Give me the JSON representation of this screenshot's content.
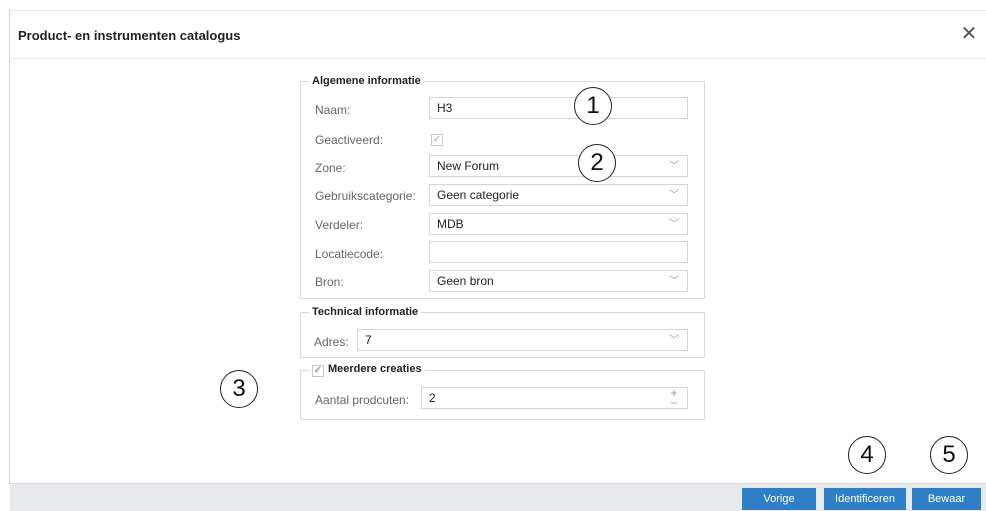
{
  "dialog": {
    "title": "Product- en instrumenten catalogus",
    "close_glyph": "✕"
  },
  "general": {
    "legend": "Algemene informatie",
    "name_label": "Naam:",
    "name_value": "H3",
    "activated_label": "Geactiveerd:",
    "activated": true,
    "zone_label": "Zone:",
    "zone_value": "New Forum",
    "usage_label": "Gebruikscategorie:",
    "usage_value": "Geen categorie",
    "distributor_label": "Verdeler:",
    "distributor_value": "MDB",
    "location_label": "Locatiecode:",
    "location_value": "",
    "source_label": "Bron:",
    "source_value": "Geen bron"
  },
  "technical": {
    "legend": "Technical informatie",
    "address_label": "Adres:",
    "address_value": "7"
  },
  "multiple": {
    "legend": "Meerdere creaties",
    "checked": true,
    "count_label": "Aantal prodcuten:",
    "count_value": "2"
  },
  "callouts": [
    "1",
    "2",
    "3",
    "4",
    "5"
  ],
  "footer": {
    "prev_label": "Vorige",
    "identify_label": "Identificeren",
    "save_label": "Bewaar"
  },
  "colors": {
    "button": "#2e7fc6",
    "footer_bg": "#e9eaec"
  }
}
